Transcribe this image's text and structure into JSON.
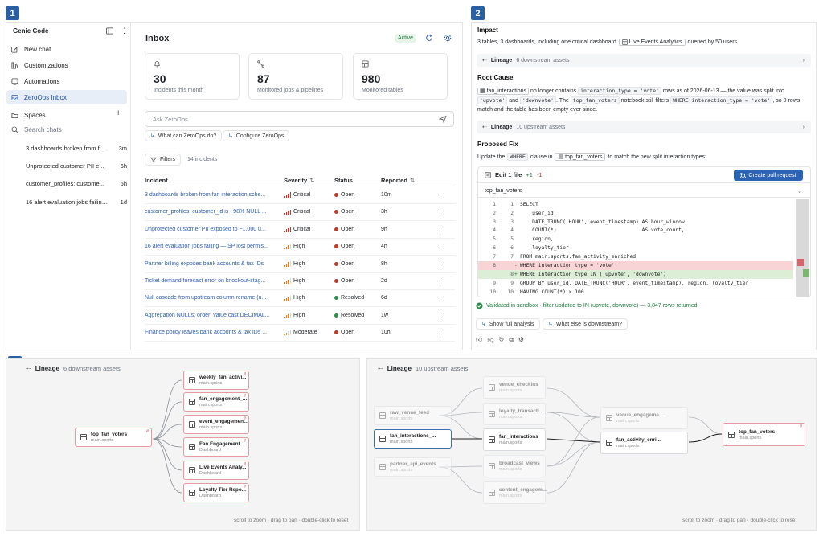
{
  "badges": [
    "1",
    "2",
    "3"
  ],
  "sidebar": {
    "app_title": "Genie Code",
    "nav": [
      {
        "label": "New chat",
        "icon": "edit-icon"
      },
      {
        "label": "Customizations",
        "icon": "library-icon"
      },
      {
        "label": "Automations",
        "icon": "automation-icon"
      },
      {
        "label": "ZeroOps Inbox",
        "icon": "inbox-icon"
      },
      {
        "label": "Spaces",
        "icon": "spaces-icon"
      }
    ],
    "search_placeholder": "Search chats",
    "chats": [
      {
        "title": "3 dashboards broken from f...",
        "time": "3m"
      },
      {
        "title": "Unprotected customer PII e...",
        "time": "6h"
      },
      {
        "title": "customer_profiles: custome...",
        "time": "6h"
      },
      {
        "title": "16 alert evaluation jobs failing...",
        "time": "1d"
      }
    ]
  },
  "inbox": {
    "title": "Inbox",
    "status": "Active",
    "stats": [
      {
        "value": "30",
        "label": "Incidents this month"
      },
      {
        "value": "87",
        "label": "Monitored jobs & pipelines"
      },
      {
        "value": "980",
        "label": "Monitored tables"
      }
    ],
    "ask_placeholder": "Ask ZeroOps...",
    "suggestions": [
      "What can ZeroOps do?",
      "Configure ZeroOps"
    ],
    "filters_label": "Filters",
    "incident_count": "14 incidents",
    "columns": [
      "Incident",
      "Severity",
      "Status",
      "Reported"
    ],
    "rows": [
      {
        "incident": "3 dashboards broken from fan interaction sche...",
        "severity": "Critical",
        "status": "Open",
        "reported": "10m"
      },
      {
        "incident": "customer_profiles: customer_id is ~98% NULL ...",
        "severity": "Critical",
        "status": "Open",
        "reported": "3h"
      },
      {
        "incident": "Unprotected customer PII exposed to ~1,000 u...",
        "severity": "Critical",
        "status": "Open",
        "reported": "9h"
      },
      {
        "incident": "16 alert evaluation jobs failing — SP lost permis...",
        "severity": "High",
        "status": "Open",
        "reported": "4h"
      },
      {
        "incident": "Partner billing exposes bank accounts & tax IDs",
        "severity": "High",
        "status": "Open",
        "reported": "8h"
      },
      {
        "incident": "Ticket demand forecast error on knockout-stag...",
        "severity": "High",
        "status": "Open",
        "reported": "2d"
      },
      {
        "incident": "Null cascade from upstream column rename (u...",
        "severity": "High",
        "status": "Resolved",
        "reported": "6d"
      },
      {
        "incident": "Aggregation NULLs: order_value cast DECIMAL...",
        "severity": "High",
        "status": "Resolved",
        "reported": "1w"
      },
      {
        "incident": "Finance policy leaves bank accounts & tax IDs ...",
        "severity": "Moderate",
        "status": "Open",
        "reported": "10h"
      }
    ]
  },
  "detail": {
    "impact_title": "Impact",
    "impact_text_1": "3 tables, 3 dashboards, including one critical dashboard",
    "impact_dashboard": "Live Events Analytics",
    "impact_text_2": "queried by 50 users",
    "lineage_down_label": "Lineage",
    "lineage_down_count": "6 downstream assets",
    "root_cause_title": "Root Cause",
    "rc_table": "fan_interactions",
    "rc_t1": "no longer contains",
    "rc_code1": "interaction_type = 'vote'",
    "rc_t2": "rows as of 2026-06-13 — the value was split into",
    "rc_code2": "'upvote'",
    "rc_t3": "and",
    "rc_code3": "'downvote'",
    "rc_t4": ". The",
    "rc_code4": "top_fan_voters",
    "rc_t5": "notebook still filters",
    "rc_code5": "WHERE interaction_type = 'vote'",
    "rc_t6": ", so 0",
    "rc_t7": "rows match and the table has been empty ever since.",
    "lineage_up_label": "Lineage",
    "lineage_up_count": "10 upstream assets",
    "fix_title": "Proposed Fix",
    "fix_t1": "Update the",
    "fix_code1": "WHERE",
    "fix_t2": "clause in",
    "fix_notebook": "top_fan_voters",
    "fix_t3": "to match the new split interaction types:",
    "edit_label": "Edit 1 file",
    "edit_plus": "+1",
    "edit_minus": "-1",
    "pr_button": "Create pull request",
    "file_name": "top_fan_voters",
    "code_lines": [
      {
        "a": "1",
        "b": "1",
        "mark": "",
        "src": "SELECT",
        "type": "ctx"
      },
      {
        "a": "2",
        "b": "2",
        "mark": "",
        "src": "    user_id,",
        "type": "ctx"
      },
      {
        "a": "3",
        "b": "3",
        "mark": "",
        "src": "    DATE_TRUNC('HOUR', event_timestamp) AS hour_window,",
        "type": "ctx"
      },
      {
        "a": "4",
        "b": "4",
        "mark": "",
        "src": "    COUNT(*)                            AS vote_count,",
        "type": "ctx"
      },
      {
        "a": "5",
        "b": "5",
        "mark": "",
        "src": "    region,",
        "type": "ctx"
      },
      {
        "a": "6",
        "b": "6",
        "mark": "",
        "src": "    loyalty_tier",
        "type": "ctx"
      },
      {
        "a": "7",
        "b": "7",
        "mark": "",
        "src": "FROM main.sports.fan_activity_enriched",
        "type": "ctx"
      },
      {
        "a": "8",
        "b": "",
        "mark": "-",
        "src": "WHERE interaction_type = 'vote'",
        "type": "del"
      },
      {
        "a": "",
        "b": "8",
        "mark": "+",
        "src": "WHERE interaction_type IN ('upvote', 'downvote')",
        "type": "add"
      },
      {
        "a": "9",
        "b": "9",
        "mark": "",
        "src": "GROUP BY user_id, DATE_TRUNC('HOUR', event_timestamp), region, loyalty_tier",
        "type": "ctx"
      },
      {
        "a": "10",
        "b": "10",
        "mark": "",
        "src": "HAVING COUNT(*) > 100",
        "type": "ctx"
      }
    ],
    "validated": "Validated in sandbox · filter updated to IN (upvote, downvote) — 3,847 rows returned",
    "actions": [
      "Show full analysis",
      "What else is downstream?"
    ]
  },
  "lineage_down": {
    "label": "Lineage",
    "count": "6 downstream assets",
    "source": {
      "name": "top_fan_voters",
      "sub": "main.sports"
    },
    "targets": [
      {
        "name": "weekly_fan_activi...",
        "sub": "main.sports"
      },
      {
        "name": "fan_engagement_kp...",
        "sub": "main.sports"
      },
      {
        "name": "event_engagement_...",
        "sub": "main.sports"
      },
      {
        "name": "Fan Engagement Da...",
        "sub": "Dashboard"
      },
      {
        "name": "Live Events Analy...",
        "sub": "Dashboard"
      },
      {
        "name": "Loyalty Tier Repo...",
        "sub": "Dashboard"
      }
    ],
    "hint": "scroll to zoom · drag to pan · double-click to reset"
  },
  "lineage_up": {
    "label": "Lineage",
    "count": "10 upstream assets",
    "col1": [
      {
        "name": "raw_venue_feed",
        "sub": "main.sports"
      },
      {
        "name": "fan_interactions_...",
        "sub": "main.sports"
      },
      {
        "name": "partner_api_events",
        "sub": "main.sports"
      }
    ],
    "col2": [
      {
        "name": "venue_checkins",
        "sub": "main.sports"
      },
      {
        "name": "loyalty_transacti...",
        "sub": "main.sports"
      },
      {
        "name": "fan_interactions",
        "sub": "main.sports"
      },
      {
        "name": "broadcast_views",
        "sub": "main.sports"
      },
      {
        "name": "content_engagement",
        "sub": "main.sports"
      }
    ],
    "col3": [
      {
        "name": "venue_engagement_...",
        "sub": "main.sports"
      },
      {
        "name": "fan_activity_enri...",
        "sub": "main.sports"
      }
    ],
    "target": {
      "name": "top_fan_voters",
      "sub": "main.sports"
    },
    "hint": "scroll to zoom · drag to pan · double-click to reset"
  }
}
